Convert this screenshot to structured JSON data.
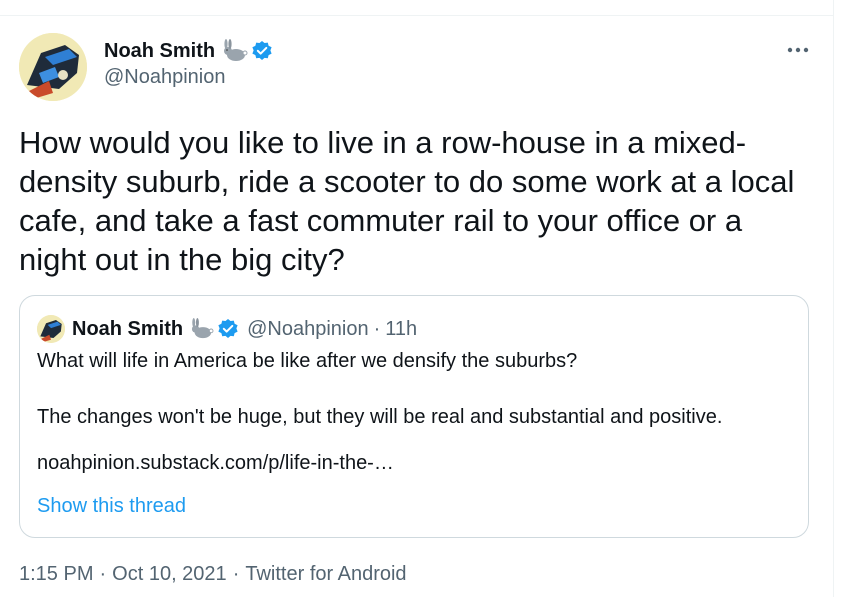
{
  "tweet": {
    "author_name": "Noah Smith",
    "author_handle": "@Noahpinion",
    "text": "How would you like to live in a row-house in a mixed-density suburb, ride a scooter to do some work at a local cafe, and take a fast commuter rail to your office or a night out in the big city?",
    "time": "1:15 PM",
    "date": "Oct 10, 2021",
    "source": "Twitter for Android",
    "separator": "·",
    "icons": {
      "emoji": "rabbit-icon",
      "verified": "verified-badge-icon",
      "more": "more-options-icon"
    }
  },
  "quoted_tweet": {
    "author_name": "Noah Smith",
    "author_handle": "@Noahpinion",
    "separator": "·",
    "age": "11h",
    "line1": "What will life in America be like after we densify the suburbs?",
    "line2": "The changes won't be huge, but they will be real and substantial and positive.",
    "link": "noahpinion.substack.com/p/life-in-the-…",
    "show_thread": "Show this thread"
  },
  "colors": {
    "text": "#0f1419",
    "secondary": "#536471",
    "accent": "#1d9bf0",
    "border": "#cfd9de"
  }
}
